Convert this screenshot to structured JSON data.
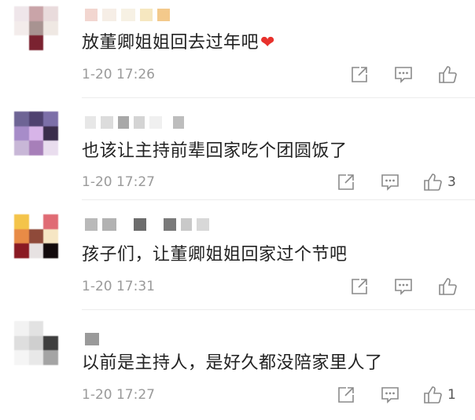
{
  "comments": [
    {
      "text": "放董卿姐姐回去过年吧",
      "emoji": "❤",
      "time": "1-20 17:26",
      "like_count": ""
    },
    {
      "text": "也该让主持前辈回家吃个团圆饭了",
      "time": "1-20 17:27",
      "like_count": "3"
    },
    {
      "text": "孩子们，让董卿姐姐回家过个节吧",
      "time": "1-20 17:31",
      "like_count": ""
    },
    {
      "text": "以前是主持人，是好久都没陪家里人了",
      "time": "1-20 17:27",
      "like_count": "1"
    }
  ],
  "icons": {
    "share": "share-icon",
    "comment": "comment-icon",
    "like": "like-icon"
  },
  "colors": {
    "text": "#222222",
    "meta": "#9a9a9a",
    "heart": "#e8312c",
    "icon": "#8a8a8a"
  }
}
